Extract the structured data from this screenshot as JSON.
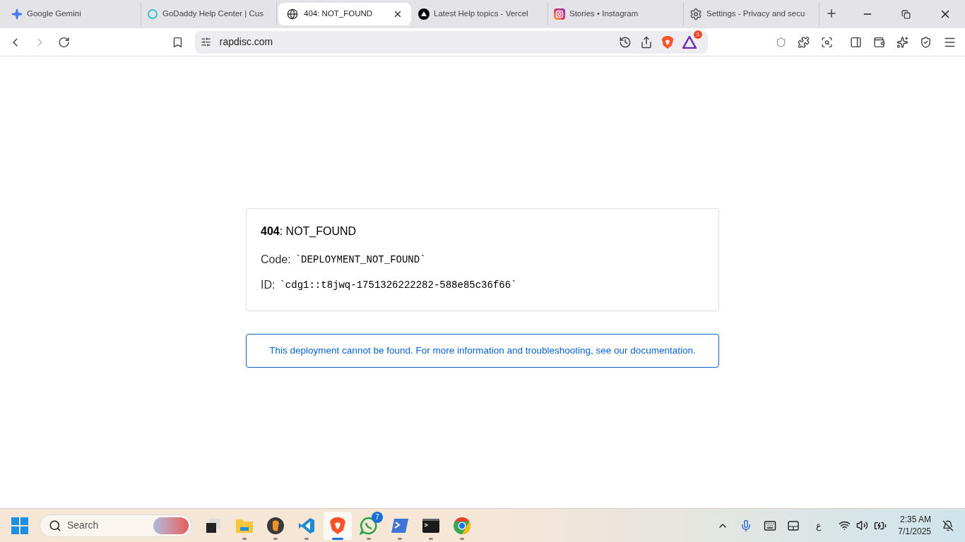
{
  "tabs": [
    {
      "title": "Google Gemini",
      "kind": "sparkle",
      "selected": false
    },
    {
      "title": "GoDaddy Help Center | Cus",
      "kind": "godaddy",
      "selected": false
    },
    {
      "title": "404: NOT_FOUND",
      "kind": "globe",
      "selected": true
    },
    {
      "title": "Latest Help topics - Vercel",
      "kind": "vercel",
      "selected": false
    },
    {
      "title": "Stories • Instagram",
      "kind": "instagram",
      "selected": false
    },
    {
      "title": "Settings - Privacy and secu",
      "kind": "gear",
      "selected": false
    }
  ],
  "address_bar": {
    "url": "rapdisc.com",
    "rewards_badge": "1"
  },
  "error_card": {
    "heading": "**404**: NOT_FOUND",
    "lines": [
      {
        "label": "Code:",
        "value": "`DEPLOYMENT_NOT_FOUND`"
      },
      {
        "label": "ID:",
        "value": "`cdg1::t8jwq-1751326222282-588e85c36f66`"
      }
    ]
  },
  "notice": "This deployment cannot be found. For more information and troubleshooting, see our documentation.",
  "taskbar": {
    "search_placeholder": "Search",
    "apps": [
      {
        "kind": "taskview",
        "running": false,
        "active": false
      },
      {
        "kind": "files",
        "running": true,
        "active": false
      },
      {
        "kind": "fruit",
        "running": true,
        "active": false
      },
      {
        "kind": "code",
        "running": true,
        "active": false
      },
      {
        "kind": "brave",
        "running": true,
        "active": true
      },
      {
        "kind": "whatsapp",
        "running": true,
        "active": false,
        "badge": "7"
      },
      {
        "kind": "powershell",
        "running": true,
        "active": false
      },
      {
        "kind": "terminal",
        "running": true,
        "active": false
      },
      {
        "kind": "chrome",
        "running": true,
        "active": false
      }
    ],
    "language": "ع",
    "time": "2:35 AM",
    "date": "7/1/2025"
  }
}
